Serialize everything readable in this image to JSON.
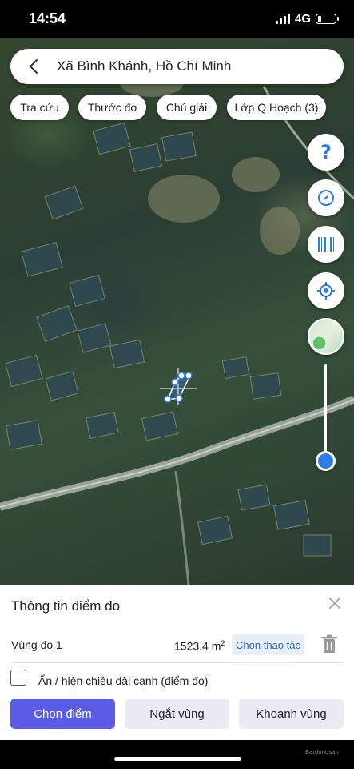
{
  "status_bar": {
    "time": "14:54",
    "network": "4G"
  },
  "search": {
    "location": "Xã Bình Khánh, Hồ Chí Minh",
    "back_icon": "chevron-left-icon"
  },
  "chips": [
    {
      "label": "Tra cứu"
    },
    {
      "label": "Thước đo"
    },
    {
      "label": "Chú giải"
    },
    {
      "label": "Lớp Q.Hoạch (3)"
    }
  ],
  "map_controls": {
    "help_icon": "question-icon",
    "compass_icon": "compass-icon",
    "barcode_icon": "barcode-icon",
    "locate_icon": "crosshair-location-icon",
    "layer_icon": "map-layer-icon",
    "accent_color": "#2b7de9"
  },
  "panel": {
    "title": "Thông tin điểm đo",
    "zone_label": "Vùng đo 1",
    "zone_area": "1523.4 m",
    "zone_area_unit_sup": "2",
    "action_label": "Chọn thao tác",
    "checkbox_label": "Ẩn / hiện chiều dài cạnh (điểm đo)",
    "checkbox_checked": false,
    "buttons": {
      "select_point": "Chọn điểm",
      "disconnect_zone": "Ngắt vùng",
      "draw_zone": "Khoanh vùng"
    },
    "primary_color": "#5b5ce6"
  },
  "watermark": "Batdongsan"
}
